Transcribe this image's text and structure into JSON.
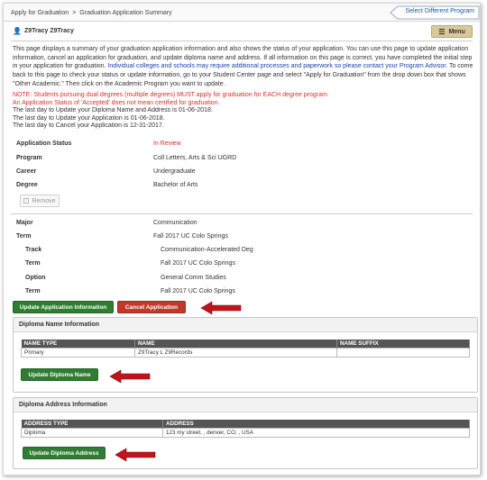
{
  "breadcrumb": {
    "item1": "Apply for Graduation",
    "separator": ">",
    "item2": "Graduation Application Summary"
  },
  "select_program_label": "Select Different Program",
  "user": {
    "name": "Z9Tracy Z9Tracy",
    "icon": "user-icon"
  },
  "menu": {
    "label": "Menu",
    "icon": "hamburger-icon"
  },
  "intro": {
    "part1": "This page displays a summary of your graduation application information and also shows the status of your application. You can use this page to update application information, cancel an application for graduation, and update diploma name and address. If all information on this page is correct, you have completed the initial step in your application for graduation. ",
    "part_blue": "Individual colleges and schools may require additional processes and paperwork so please contact your Program Advisor.",
    "part2": " To come back to this page to check your status or update information, go to your Student Center page and select \"Apply for Graduation\" from the drop down box that shows \"Other Academic.\" Then click on the Academic Program you want to update."
  },
  "notes": {
    "note1": "NOTE: Students pursuing dual degrees (multiple degrees) MUST apply for graduation for EACH degree program.",
    "note2": "An Application Status of 'Accepted' does not mean certified for graduation.",
    "line1": "The last day to Update your Diploma Name and Address is 01-06-2018.",
    "line2": "The last day to Update your Application is 01-06-2018.",
    "line3": "The last day to Cancel your Application  is 12-31-2017."
  },
  "details": [
    {
      "key": "Application Status",
      "value": "In Review"
    },
    {
      "key": "Program",
      "value": "Coll Letters, Arts & Sci UGRD"
    },
    {
      "key": "Career",
      "value": "Undergraduate"
    },
    {
      "key": "Degree",
      "value": "Bachelor of Arts"
    }
  ],
  "remove_label": "Remove",
  "major": {
    "key": "Major",
    "value": "Communication"
  },
  "term": {
    "key": "Term",
    "value": "Fall 2017 UC Colo Springs"
  },
  "sub": [
    {
      "key": "Track",
      "value": "Communication-Accelerated Deg"
    },
    {
      "key": "Term",
      "value": "Fall 2017 UC Colo Springs"
    },
    {
      "key": "Option",
      "value": "General Comm Studies"
    },
    {
      "key": "Term",
      "value": "Fall 2017 UC Colo Springs"
    }
  ],
  "buttons": {
    "update_app": "Update Application Information",
    "cancel_app": "Cancel Application",
    "update_name": "Update Diploma Name",
    "update_address": "Update Diploma Address"
  },
  "diploma_name": {
    "title": "Diploma Name Information",
    "headers": [
      "NAME TYPE",
      "NAME",
      "NAME SUFFIX"
    ],
    "row": [
      "Primary",
      "Z9Tracy L Z9Records",
      ""
    ]
  },
  "diploma_address": {
    "title": "Diploma Address Information",
    "headers": [
      "ADDRESS TYPE",
      "ADDRESS"
    ],
    "row": [
      "Diploma",
      "123 my street, , denver, CO, , USA"
    ]
  },
  "colors": {
    "status_red": "#d83030",
    "button_green": "#2f7d32",
    "button_red": "#c0392b",
    "annotation_arrow": "#c0141c",
    "link_blue": "#1a56a8"
  }
}
